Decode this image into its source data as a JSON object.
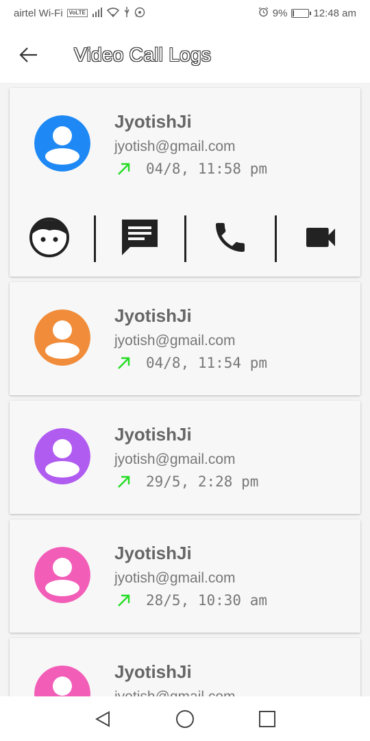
{
  "status_bar": {
    "carrier": "airtel Wi-Fi",
    "volte": "VoLTE",
    "battery": "9%",
    "battery_level": 0.09,
    "time": "12:48 am",
    "icons": [
      "signal-icon",
      "wifi-icon",
      "usb-icon",
      "whatsapp-icon",
      "alarm-icon",
      "battery-icon"
    ]
  },
  "app_bar": {
    "title": "Video Call Logs",
    "back_icon": "arrow-back-icon"
  },
  "calls": [
    {
      "name": "JyotishJi",
      "email": "jyotish@gmail.com",
      "time": "04/8, 11:58 pm",
      "avatar_color": "#1e88f5",
      "direction": "outgoing",
      "expanded": true
    },
    {
      "name": "JyotishJi",
      "email": "jyotish@gmail.com",
      "time": "04/8, 11:54 pm",
      "avatar_color": "#f08c3a",
      "direction": "outgoing",
      "expanded": false
    },
    {
      "name": "JyotishJi",
      "email": "jyotish@gmail.com",
      "time": "29/5, 2:28 pm",
      "avatar_color": "#b05cf0",
      "direction": "outgoing",
      "expanded": false
    },
    {
      "name": "JyotishJi",
      "email": "jyotish@gmail.com",
      "time": "28/5, 10:30 am",
      "avatar_color": "#f25db8",
      "direction": "outgoing",
      "expanded": false
    },
    {
      "name": "JyotishJi",
      "email": "jyotish@gmail.com",
      "time": "",
      "avatar_color": "#f25db8",
      "direction": "outgoing",
      "expanded": false
    }
  ],
  "actions": [
    "profile-face-icon",
    "message-icon",
    "phone-icon",
    "videocam-icon"
  ],
  "colors": {
    "outgoing_arrow": "#22dd22",
    "text_primary": "#666666",
    "text_secondary": "#777777",
    "card_bg": "#f7f7f7",
    "list_bg": "#f4f4f4"
  },
  "nav_bar": [
    "back-triangle-icon",
    "home-circle-icon",
    "recents-square-icon"
  ]
}
